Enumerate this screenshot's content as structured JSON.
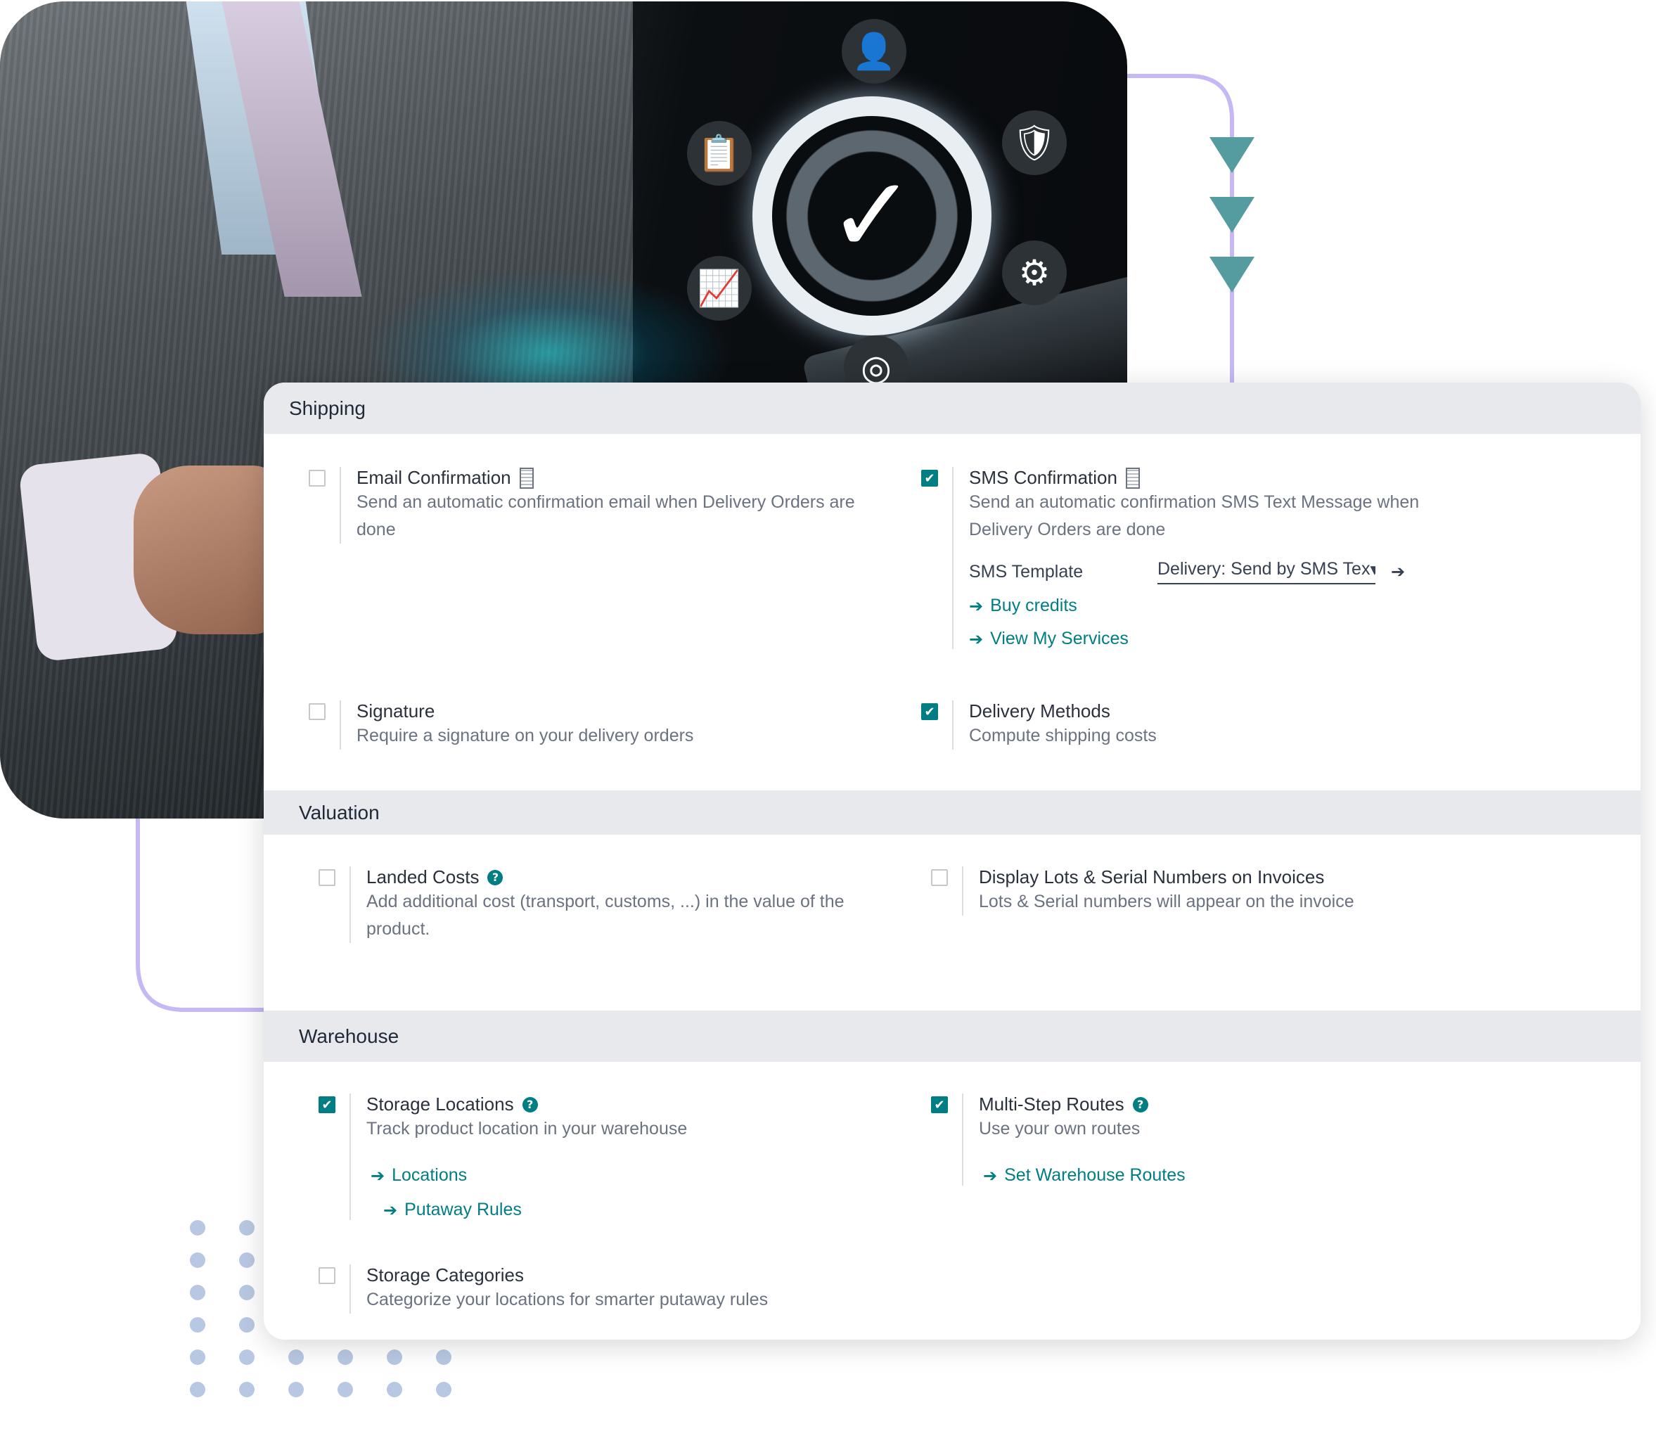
{
  "colors": {
    "accent": "#017e84",
    "connector": "#c5b8f5",
    "arrow": "#549c9f",
    "section_bg": "#e8e9ed"
  },
  "hero": {
    "icons": [
      "user-icon",
      "clipboard-checklist-icon",
      "shield-check-icon",
      "growth-chart-icon",
      "gears-icon",
      "badge-check-icon",
      "check-dial-icon"
    ]
  },
  "sections": {
    "shipping": {
      "title": "Shipping",
      "email": {
        "label": "Email Confirmation",
        "desc": "Send an automatic confirmation email when Delivery Orders are done",
        "checked": false
      },
      "sms": {
        "label": "SMS Confirmation",
        "desc": "Send an automatic confirmation SMS Text Message when Delivery Orders are done",
        "checked": true,
        "template_label": "SMS Template",
        "template_value": "Delivery: Send by SMS Tex",
        "buy_credits": "Buy credits",
        "view_services": "View My Services"
      },
      "signature": {
        "label": "Signature",
        "desc": "Require a signature on your delivery orders",
        "checked": false
      },
      "delivery": {
        "label": "Delivery Methods",
        "desc": "Compute shipping costs",
        "checked": true
      }
    },
    "valuation": {
      "title": "Valuation",
      "landed": {
        "label": "Landed Costs",
        "desc": "Add additional cost (transport, customs, ...) in the value of the product.",
        "checked": false
      },
      "lots": {
        "label": "Display Lots & Serial Numbers on Invoices",
        "desc": "Lots & Serial numbers will appear on the invoice",
        "checked": false
      }
    },
    "warehouse": {
      "title": "Warehouse",
      "storage": {
        "label": "Storage Locations",
        "desc": "Track product location in your warehouse",
        "checked": true,
        "link1": "Locations",
        "link2": "Putaway Rules"
      },
      "routes": {
        "label": "Multi-Step Routes",
        "desc": "Use your own routes",
        "checked": true,
        "link1": "Set Warehouse Routes"
      },
      "categories": {
        "label": "Storage Categories",
        "desc": "Categorize your locations for smarter putaway rules",
        "checked": false
      }
    }
  },
  "glyphs": {
    "check": "✔",
    "arrow": "➔",
    "caret": "▾",
    "help": "?",
    "user": "👤",
    "clipboard": "📋",
    "shield": "🛡",
    "chart": "📈",
    "gears": "⚙",
    "badge": "◎",
    "bigcheck": "✓"
  }
}
